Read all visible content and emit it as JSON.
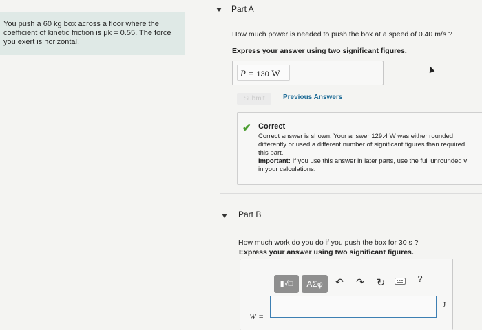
{
  "problem": {
    "lines": [
      "You push a 60 kg box across a floor where the",
      "coefficient of kinetic friction is μk = 0.55. The force",
      "you exert is horizontal."
    ]
  },
  "part_a": {
    "title": "Part A",
    "question": "How much power is needed to push the box at a speed of 0.40 m/s ?",
    "instruction": "Express your answer using two significant figures.",
    "answer_label": "P =",
    "answer_value": "130",
    "answer_unit": "W",
    "submit_label": "Submit",
    "previous_answers_label": "Previous Answers",
    "feedback": {
      "title": "Correct",
      "lines": [
        "Correct answer is shown. Your answer 129.4 W was either rounded",
        "differently or used a different number of significant figures than required",
        "this part."
      ],
      "important_label": "Important:",
      "important_lines": [
        " If you use this answer in later parts, use the full unrounded v",
        "in your calculations."
      ]
    }
  },
  "part_b": {
    "title": "Part B",
    "question": "How much work do you do if you push the box for 30 s ?",
    "instruction": "Express your answer using two significant figures.",
    "toolbar": {
      "template_label": "▮√□",
      "greek_label": "ΑΣφ",
      "help_label": "?",
      "icons": [
        "undo-icon",
        "redo-icon",
        "reset-icon",
        "keyboard-icon",
        "help-icon"
      ]
    },
    "answer_label": "W =",
    "answer_value": "",
    "answer_unit": "J"
  },
  "colors": {
    "problem_bg": "#dfe9e6",
    "link": "#1f6c97",
    "check": "#4a9d2f",
    "input_border": "#3d7fb3",
    "toolbar_button": "#8f8f8f"
  }
}
